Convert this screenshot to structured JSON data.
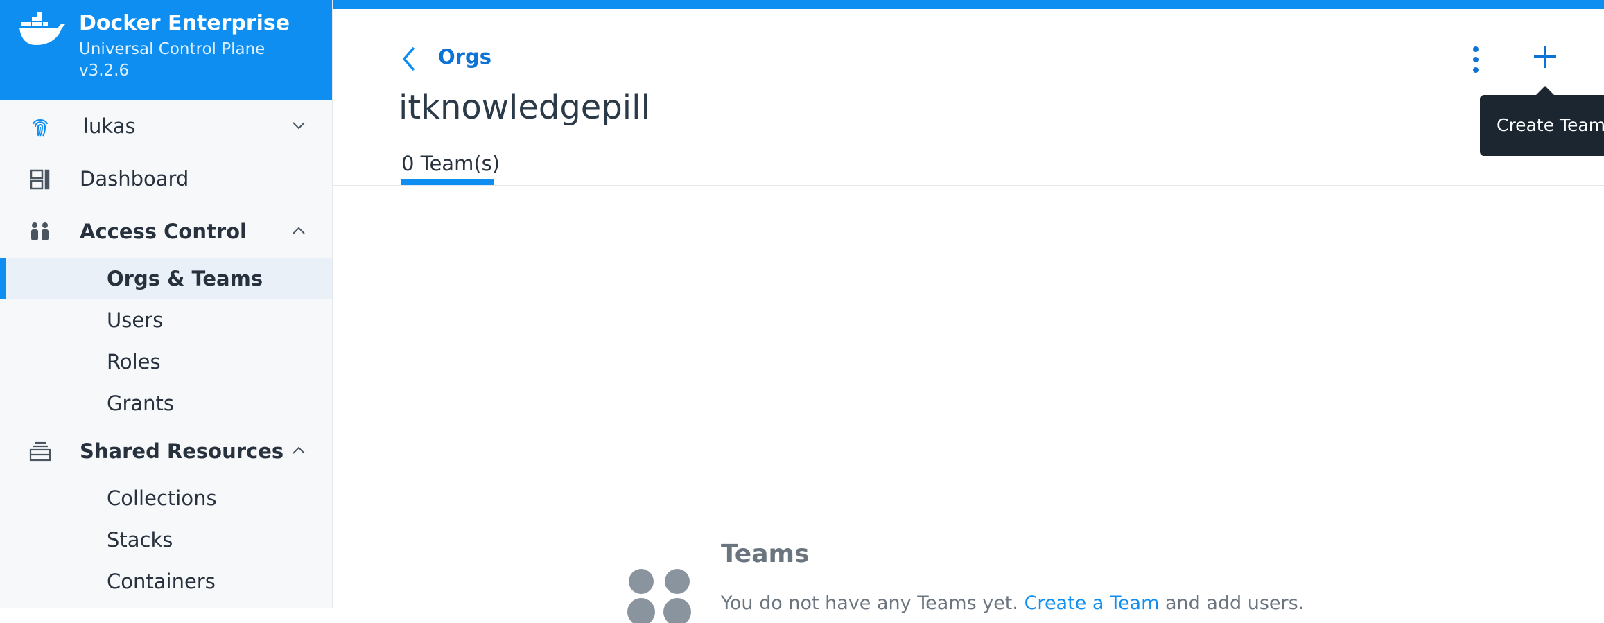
{
  "brand": {
    "title": "Docker Enterprise",
    "subtitle": "Universal Control Plane",
    "version": "v3.2.6",
    "color": "#0d8ef0"
  },
  "sidebar": {
    "user": {
      "label": "lukas",
      "icon": "fingerprint-icon"
    },
    "items": [
      {
        "label": "Dashboard",
        "icon": "dashboard-icon"
      },
      {
        "label": "Access Control",
        "icon": "people-icon",
        "expanded": true,
        "children": [
          {
            "label": "Orgs & Teams",
            "active": true
          },
          {
            "label": "Users"
          },
          {
            "label": "Roles"
          },
          {
            "label": "Grants"
          }
        ]
      },
      {
        "label": "Shared Resources",
        "icon": "stack-icon",
        "expanded": true,
        "children": [
          {
            "label": "Collections"
          },
          {
            "label": "Stacks"
          },
          {
            "label": "Containers"
          }
        ]
      }
    ]
  },
  "header": {
    "breadcrumb": "Orgs",
    "title": "itknowledgepill",
    "tabs": [
      {
        "label": "0 Team(s)",
        "active": true
      }
    ],
    "tooltip": "Create Team"
  },
  "empty_state": {
    "title": "Teams",
    "text_before": "You do not have any Teams yet. ",
    "link": "Create a Team",
    "text_after": " and add users."
  }
}
